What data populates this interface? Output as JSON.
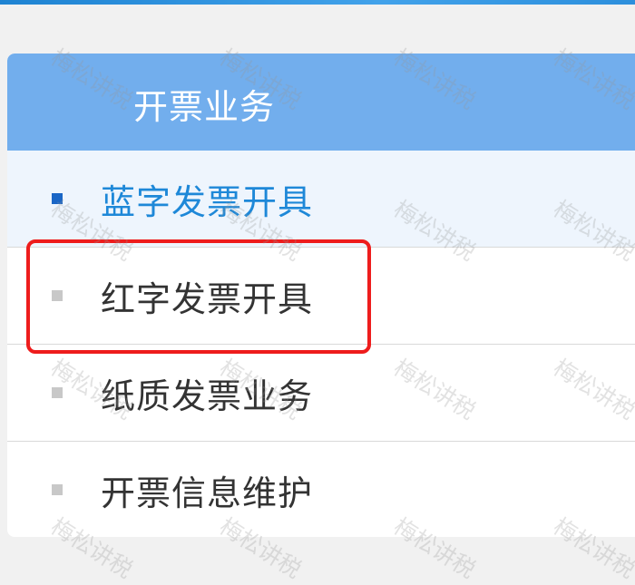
{
  "panel": {
    "title": "开票业务"
  },
  "menu": {
    "items": [
      {
        "label": "蓝字发票开具",
        "active": true
      },
      {
        "label": "红字发票开具",
        "active": false,
        "highlighted": true
      },
      {
        "label": "纸质发票业务",
        "active": false
      },
      {
        "label": "开票信息维护",
        "active": false
      }
    ]
  },
  "watermark": {
    "text": "梅松讲税"
  },
  "colors": {
    "header_bg": "#72aeed",
    "active_text": "#1e88d8",
    "active_bullet": "#1a66c6",
    "highlight_border": "#ee1c1c"
  }
}
